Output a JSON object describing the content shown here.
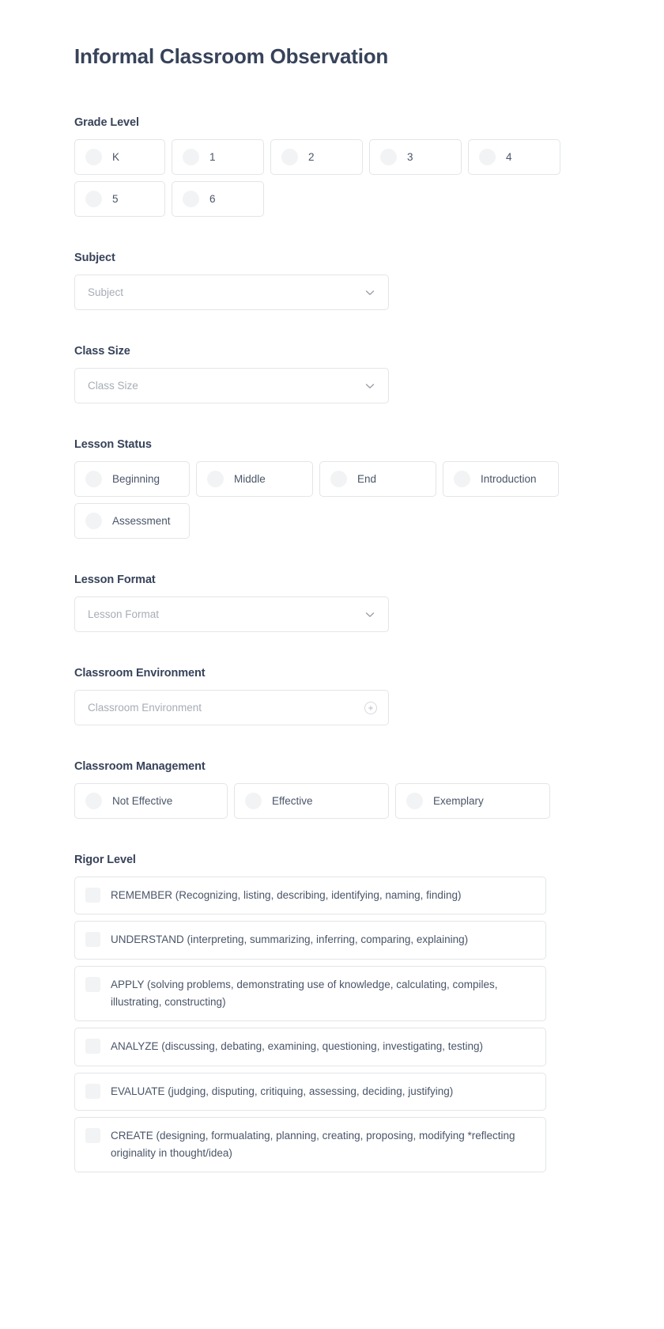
{
  "form": {
    "title": "Informal Classroom Observation"
  },
  "sections": {
    "grade_level": {
      "label": "Grade Level",
      "options": [
        "K",
        "1",
        "2",
        "3",
        "4",
        "5",
        "6"
      ]
    },
    "subject": {
      "label": "Subject",
      "placeholder": "Subject",
      "value": "",
      "icon": "chevron-down-icon"
    },
    "class_size": {
      "label": "Class Size",
      "placeholder": "Class Size",
      "value": "",
      "icon": "chevron-down-icon"
    },
    "lesson_status": {
      "label": "Lesson Status",
      "options": [
        "Beginning",
        "Middle",
        "End",
        "Introduction",
        "Assessment"
      ]
    },
    "lesson_format": {
      "label": "Lesson Format",
      "placeholder": "Lesson Format",
      "value": "",
      "icon": "chevron-down-icon"
    },
    "classroom_environment": {
      "label": "Classroom Environment",
      "placeholder": "Classroom Environment",
      "value": "",
      "icon": "plus-circle-icon",
      "icon_glyph": "+"
    },
    "classroom_management": {
      "label": "Classroom Management",
      "options": [
        "Not Effective",
        "Effective",
        "Exemplary"
      ]
    },
    "rigor_level": {
      "label": "Rigor Level",
      "options": [
        "REMEMBER (Recognizing, listing, describing, identifying, naming, finding)",
        "UNDERSTAND (interpreting, summarizing, inferring, comparing, explaining)",
        "APPLY (solving problems, demonstrating use of knowledge, calculating, compiles, illustrating, constructing)",
        "ANALYZE (discussing, debating, examining, questioning, investigating, testing)",
        "EVALUATE (judging, disputing, critiquing, assessing, deciding, justifying)",
        "CREATE (designing, formualating, planning, creating, proposing, modifying *reflecting originality in thought/idea)"
      ]
    }
  },
  "colors": {
    "title": "#37435a",
    "label": "#37435a",
    "text": "#4a5568",
    "placeholder": "#a7adb6",
    "border": "#e3e5e8",
    "control_fill": "#f2f3f4"
  }
}
